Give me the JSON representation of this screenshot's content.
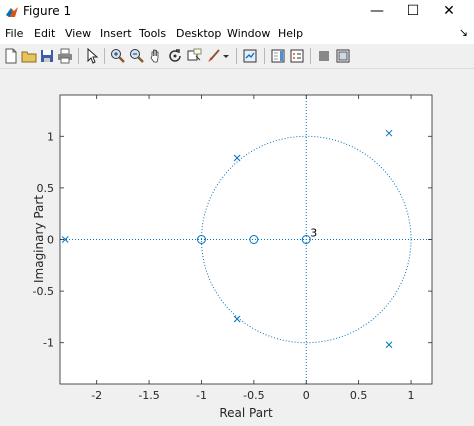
{
  "window": {
    "title": "Figure 1",
    "controls": [
      "—",
      "☐",
      "✕"
    ]
  },
  "menubar": {
    "items": [
      "File",
      "Edit",
      "View",
      "Insert",
      "Tools",
      "Desktop",
      "Window",
      "Help"
    ],
    "overflow_arrow": "↘"
  },
  "toolbar": {
    "icons": [
      "new-figure-icon",
      "open-file-icon",
      "save-icon",
      "print-icon",
      "pointer-icon",
      "zoom-in-icon",
      "zoom-out-icon",
      "pan-hand-icon",
      "rotate-3d-icon",
      "data-cursor-icon",
      "brush-icon",
      "dropdown-arrow-icon",
      "link-plot-icon",
      "insert-colorbar-icon",
      "insert-legend-icon",
      "hide-plot-tools-icon",
      "show-plot-tools-icon"
    ]
  },
  "colors": {
    "plot": "#0072bd",
    "axes": "#262626",
    "grid": "#e6e6e6"
  },
  "chart_data": {
    "type": "scatter",
    "title": "",
    "xlabel": "Real Part",
    "ylabel": "Imaginary Part",
    "xlim": [
      -2.35,
      1.2
    ],
    "ylim": [
      -1.4,
      1.4
    ],
    "xticks": [
      -2,
      -1.5,
      -1,
      -0.5,
      0,
      0.5,
      1
    ],
    "yticks": [
      -1,
      -0.5,
      0,
      0.5,
      1
    ],
    "xtick_labels": [
      "-2",
      "-1.5",
      "-1",
      "-0.5",
      "0",
      "0.5",
      "1"
    ],
    "ytick_labels": [
      "-1",
      "-0.5",
      "0",
      "0.5",
      "1"
    ],
    "unit_circle": true,
    "zeros": [
      {
        "x": -1.0,
        "y": 0
      },
      {
        "x": -0.5,
        "y": 0
      },
      {
        "x": 0.0,
        "y": 0
      }
    ],
    "poles": [
      {
        "x": -2.3,
        "y": 0
      },
      {
        "x": -0.66,
        "y": 0.79
      },
      {
        "x": -0.66,
        "y": -0.77
      },
      {
        "x": 0.79,
        "y": 1.03
      },
      {
        "x": 0.79,
        "y": -1.02
      }
    ],
    "annotations": [
      {
        "x": 0.0,
        "y": 0,
        "text": "3"
      }
    ]
  }
}
